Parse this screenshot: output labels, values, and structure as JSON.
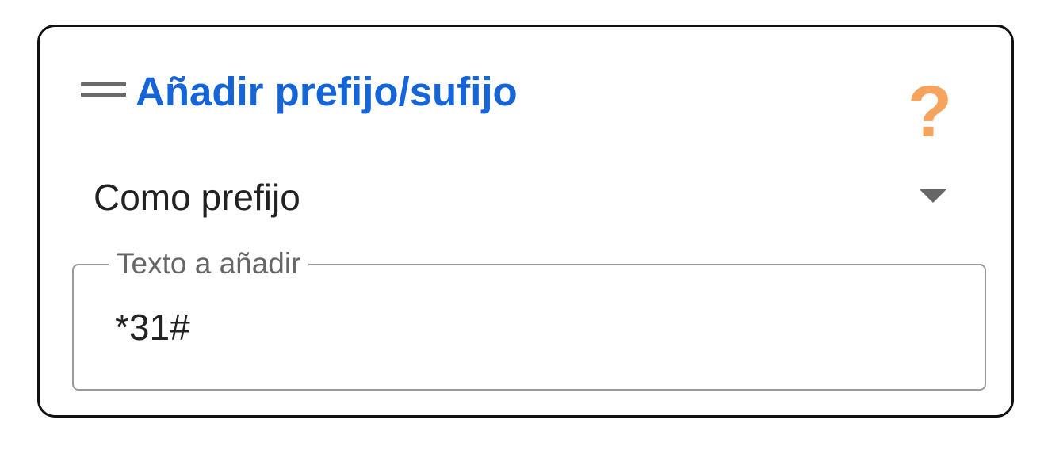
{
  "panel": {
    "title": "Añadir prefijo/sufijo",
    "help_icon": "?",
    "icons": {
      "drag": "drag-handle-icon",
      "help": "help-icon",
      "dropdown": "chevron-down-icon"
    }
  },
  "mode_select": {
    "selected": "Como prefijo"
  },
  "text_field": {
    "label": "Texto a añadir",
    "value": "*31#"
  },
  "colors": {
    "title": "#1565d8",
    "help": "#f6a35c",
    "border": "#111111",
    "field_border": "#9a9a9a"
  }
}
